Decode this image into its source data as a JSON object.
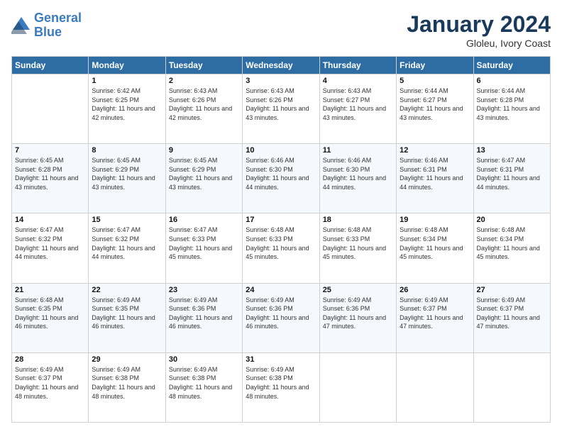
{
  "header": {
    "logo_line1": "General",
    "logo_line2": "Blue",
    "month": "January 2024",
    "location": "Gloleu, Ivory Coast"
  },
  "days": [
    "Sunday",
    "Monday",
    "Tuesday",
    "Wednesday",
    "Thursday",
    "Friday",
    "Saturday"
  ],
  "weeks": [
    [
      {
        "date": "",
        "sunrise": "",
        "sunset": "",
        "daylight": ""
      },
      {
        "date": "1",
        "sunrise": "Sunrise: 6:42 AM",
        "sunset": "Sunset: 6:25 PM",
        "daylight": "Daylight: 11 hours and 42 minutes."
      },
      {
        "date": "2",
        "sunrise": "Sunrise: 6:43 AM",
        "sunset": "Sunset: 6:26 PM",
        "daylight": "Daylight: 11 hours and 42 minutes."
      },
      {
        "date": "3",
        "sunrise": "Sunrise: 6:43 AM",
        "sunset": "Sunset: 6:26 PM",
        "daylight": "Daylight: 11 hours and 43 minutes."
      },
      {
        "date": "4",
        "sunrise": "Sunrise: 6:43 AM",
        "sunset": "Sunset: 6:27 PM",
        "daylight": "Daylight: 11 hours and 43 minutes."
      },
      {
        "date": "5",
        "sunrise": "Sunrise: 6:44 AM",
        "sunset": "Sunset: 6:27 PM",
        "daylight": "Daylight: 11 hours and 43 minutes."
      },
      {
        "date": "6",
        "sunrise": "Sunrise: 6:44 AM",
        "sunset": "Sunset: 6:28 PM",
        "daylight": "Daylight: 11 hours and 43 minutes."
      }
    ],
    [
      {
        "date": "7",
        "sunrise": "Sunrise: 6:45 AM",
        "sunset": "Sunset: 6:28 PM",
        "daylight": "Daylight: 11 hours and 43 minutes."
      },
      {
        "date": "8",
        "sunrise": "Sunrise: 6:45 AM",
        "sunset": "Sunset: 6:29 PM",
        "daylight": "Daylight: 11 hours and 43 minutes."
      },
      {
        "date": "9",
        "sunrise": "Sunrise: 6:45 AM",
        "sunset": "Sunset: 6:29 PM",
        "daylight": "Daylight: 11 hours and 43 minutes."
      },
      {
        "date": "10",
        "sunrise": "Sunrise: 6:46 AM",
        "sunset": "Sunset: 6:30 PM",
        "daylight": "Daylight: 11 hours and 44 minutes."
      },
      {
        "date": "11",
        "sunrise": "Sunrise: 6:46 AM",
        "sunset": "Sunset: 6:30 PM",
        "daylight": "Daylight: 11 hours and 44 minutes."
      },
      {
        "date": "12",
        "sunrise": "Sunrise: 6:46 AM",
        "sunset": "Sunset: 6:31 PM",
        "daylight": "Daylight: 11 hours and 44 minutes."
      },
      {
        "date": "13",
        "sunrise": "Sunrise: 6:47 AM",
        "sunset": "Sunset: 6:31 PM",
        "daylight": "Daylight: 11 hours and 44 minutes."
      }
    ],
    [
      {
        "date": "14",
        "sunrise": "Sunrise: 6:47 AM",
        "sunset": "Sunset: 6:32 PM",
        "daylight": "Daylight: 11 hours and 44 minutes."
      },
      {
        "date": "15",
        "sunrise": "Sunrise: 6:47 AM",
        "sunset": "Sunset: 6:32 PM",
        "daylight": "Daylight: 11 hours and 44 minutes."
      },
      {
        "date": "16",
        "sunrise": "Sunrise: 6:47 AM",
        "sunset": "Sunset: 6:33 PM",
        "daylight": "Daylight: 11 hours and 45 minutes."
      },
      {
        "date": "17",
        "sunrise": "Sunrise: 6:48 AM",
        "sunset": "Sunset: 6:33 PM",
        "daylight": "Daylight: 11 hours and 45 minutes."
      },
      {
        "date": "18",
        "sunrise": "Sunrise: 6:48 AM",
        "sunset": "Sunset: 6:33 PM",
        "daylight": "Daylight: 11 hours and 45 minutes."
      },
      {
        "date": "19",
        "sunrise": "Sunrise: 6:48 AM",
        "sunset": "Sunset: 6:34 PM",
        "daylight": "Daylight: 11 hours and 45 minutes."
      },
      {
        "date": "20",
        "sunrise": "Sunrise: 6:48 AM",
        "sunset": "Sunset: 6:34 PM",
        "daylight": "Daylight: 11 hours and 45 minutes."
      }
    ],
    [
      {
        "date": "21",
        "sunrise": "Sunrise: 6:48 AM",
        "sunset": "Sunset: 6:35 PM",
        "daylight": "Daylight: 11 hours and 46 minutes."
      },
      {
        "date": "22",
        "sunrise": "Sunrise: 6:49 AM",
        "sunset": "Sunset: 6:35 PM",
        "daylight": "Daylight: 11 hours and 46 minutes."
      },
      {
        "date": "23",
        "sunrise": "Sunrise: 6:49 AM",
        "sunset": "Sunset: 6:36 PM",
        "daylight": "Daylight: 11 hours and 46 minutes."
      },
      {
        "date": "24",
        "sunrise": "Sunrise: 6:49 AM",
        "sunset": "Sunset: 6:36 PM",
        "daylight": "Daylight: 11 hours and 46 minutes."
      },
      {
        "date": "25",
        "sunrise": "Sunrise: 6:49 AM",
        "sunset": "Sunset: 6:36 PM",
        "daylight": "Daylight: 11 hours and 47 minutes."
      },
      {
        "date": "26",
        "sunrise": "Sunrise: 6:49 AM",
        "sunset": "Sunset: 6:37 PM",
        "daylight": "Daylight: 11 hours and 47 minutes."
      },
      {
        "date": "27",
        "sunrise": "Sunrise: 6:49 AM",
        "sunset": "Sunset: 6:37 PM",
        "daylight": "Daylight: 11 hours and 47 minutes."
      }
    ],
    [
      {
        "date": "28",
        "sunrise": "Sunrise: 6:49 AM",
        "sunset": "Sunset: 6:37 PM",
        "daylight": "Daylight: 11 hours and 48 minutes."
      },
      {
        "date": "29",
        "sunrise": "Sunrise: 6:49 AM",
        "sunset": "Sunset: 6:38 PM",
        "daylight": "Daylight: 11 hours and 48 minutes."
      },
      {
        "date": "30",
        "sunrise": "Sunrise: 6:49 AM",
        "sunset": "Sunset: 6:38 PM",
        "daylight": "Daylight: 11 hours and 48 minutes."
      },
      {
        "date": "31",
        "sunrise": "Sunrise: 6:49 AM",
        "sunset": "Sunset: 6:38 PM",
        "daylight": "Daylight: 11 hours and 48 minutes."
      },
      {
        "date": "",
        "sunrise": "",
        "sunset": "",
        "daylight": ""
      },
      {
        "date": "",
        "sunrise": "",
        "sunset": "",
        "daylight": ""
      },
      {
        "date": "",
        "sunrise": "",
        "sunset": "",
        "daylight": ""
      }
    ]
  ]
}
